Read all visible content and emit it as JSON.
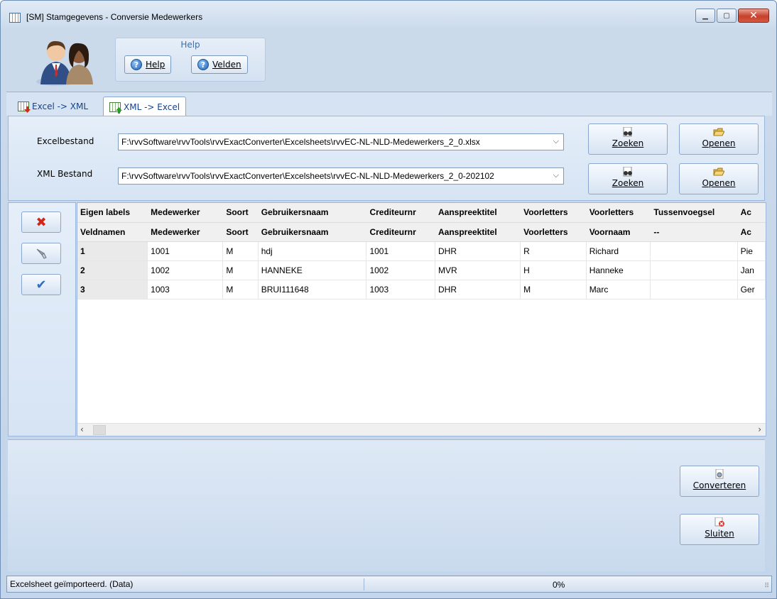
{
  "window": {
    "title": "[SM]  Stamgegevens - Conversie Medewerkers"
  },
  "toolbar": {
    "group_title": "Help",
    "help_label": "Help",
    "fields_label": "Velden"
  },
  "tabs": [
    {
      "label": "Excel -> XML",
      "active": false
    },
    {
      "label": "XML -> Excel",
      "active": true
    }
  ],
  "files": {
    "excel_label": "Excelbestand",
    "excel_value": "F:\\rvvSoftware\\rvvTools\\rvvExactConverter\\Excelsheets\\rvvEC-NL-NLD-Medewerkers_2_0.xlsx",
    "xml_label": "XML Bestand",
    "xml_value": "F:\\rvvSoftware\\rvvTools\\rvvExactConverter\\Excelsheets\\rvvEC-NL-NLD-Medewerkers_2_0-202102",
    "search_label": "Zoeken",
    "open_label": "Openen"
  },
  "grid": {
    "label_row": [
      "Eigen labels",
      "Medewerker",
      "Soort",
      "Gebruikersnaam",
      "Crediteurnr",
      "Aanspreektitel",
      "Voorletters",
      "Voorletters",
      "Tussenvoegsel",
      "Ac"
    ],
    "field_row": [
      "Veldnamen",
      "Medewerker",
      "Soort",
      "Gebruikersnaam",
      "Crediteurnr",
      "Aanspreektitel",
      "Voorletters",
      "Voornaam",
      "--",
      "Ac"
    ],
    "rows": [
      [
        "1",
        "1001",
        "M",
        "hdj",
        "1001",
        "DHR",
        "R",
        "Richard",
        "",
        "Pie"
      ],
      [
        "2",
        "1002",
        "M",
        "HANNEKE",
        "1002",
        "MVR",
        "H",
        "Hanneke",
        "",
        "Jan"
      ],
      [
        "3",
        "1003",
        "M",
        "BRUI111648",
        "1003",
        "DHR",
        "M",
        "Marc",
        "",
        "Ger"
      ]
    ]
  },
  "actions": {
    "convert_label": "Converteren",
    "close_label": "Sluiten"
  },
  "status": {
    "message": "Excelsheet geïmporteerd. (Data)",
    "progress": "0%"
  }
}
